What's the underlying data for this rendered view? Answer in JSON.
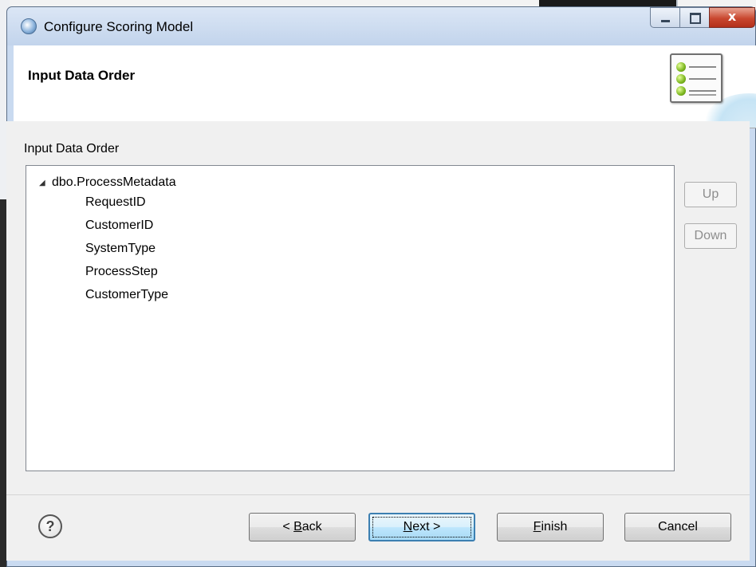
{
  "window": {
    "title": "Configure Scoring Model",
    "controls": {
      "minimize": "minimize",
      "maximize": "maximize",
      "close_glyph": "x"
    }
  },
  "header": {
    "page_title": "Input Data Order",
    "icon": "list-with-green-bullets-icon"
  },
  "main": {
    "group_label": "Input Data Order",
    "tree": {
      "root": {
        "expander": "◢",
        "label": "dbo.ProcessMetadata",
        "expanded": true
      },
      "items": [
        "RequestID",
        "CustomerID",
        "SystemType",
        "ProcessStep",
        "CustomerType"
      ]
    },
    "side_buttons": {
      "up": "Up",
      "down": "Down",
      "enabled": false
    }
  },
  "footer": {
    "help": "?",
    "back": {
      "prefix": "< ",
      "mnemonic": "B",
      "rest": "ack"
    },
    "next": {
      "mnemonic": "N",
      "rest": "ext >"
    },
    "finish": {
      "mnemonic": "F",
      "rest": "inish"
    },
    "cancel": "Cancel"
  },
  "colors": {
    "titlebar": "#c9daf0",
    "close_button": "#c9472f",
    "default_button_border": "#3c7fb1",
    "icon_bullet": "#7ab51d"
  }
}
